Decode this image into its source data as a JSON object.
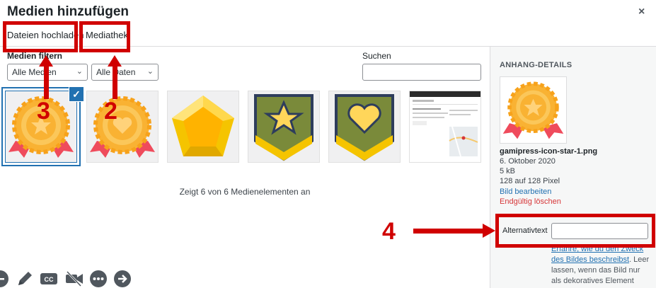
{
  "modal": {
    "title": "Medien hinzufügen",
    "close_symbol": "×"
  },
  "tabs": [
    {
      "label": "Dateien hochladen"
    },
    {
      "label": "Mediathek"
    }
  ],
  "filters": {
    "label": "Medien filtern",
    "type_selected": "Alle Medien",
    "date_selected": "Alle Daten"
  },
  "search": {
    "label": "Suchen",
    "placeholder": ""
  },
  "media_items": [
    {
      "icon": "award-star-icon",
      "selected": true
    },
    {
      "icon": "award-heart-icon",
      "selected": false
    },
    {
      "icon": "gem-pentagon-icon",
      "selected": false
    },
    {
      "icon": "chevron-star-badge-icon",
      "selected": false
    },
    {
      "icon": "chevron-heart-badge-icon",
      "selected": false
    },
    {
      "icon": "website-screenshot-thumbnail",
      "selected": false
    }
  ],
  "checkmark": "✓",
  "count_text": "Zeigt 6 von 6 Medienelementen an",
  "attachment_details": {
    "heading": "ANHANG-DETAILS",
    "filename": "gamipress-icon-star-1.png",
    "date": "6. Oktober 2020",
    "filesize": "5 kB",
    "dimensions": "128 auf 128 Pixel",
    "edit_link": "Bild bearbeiten",
    "delete_link": "Endgültig löschen",
    "alt_label": "Alternativtext",
    "alt_value": "",
    "help_link_1": "Erfahre, wie du den Zweck",
    "help_link_2": "des Bildes beschreibst",
    "help_rest": ". Leer lassen, wenn das Bild nur als dekoratives Element dient."
  },
  "annotations": {
    "label_2": "2",
    "label_3": "3",
    "label_4": "4"
  },
  "colors": {
    "accent": "#2271b1",
    "danger": "#d63638",
    "annotation": "#d00000",
    "award_gold": "#f9b233",
    "ribbon": "#ef4b5c"
  }
}
